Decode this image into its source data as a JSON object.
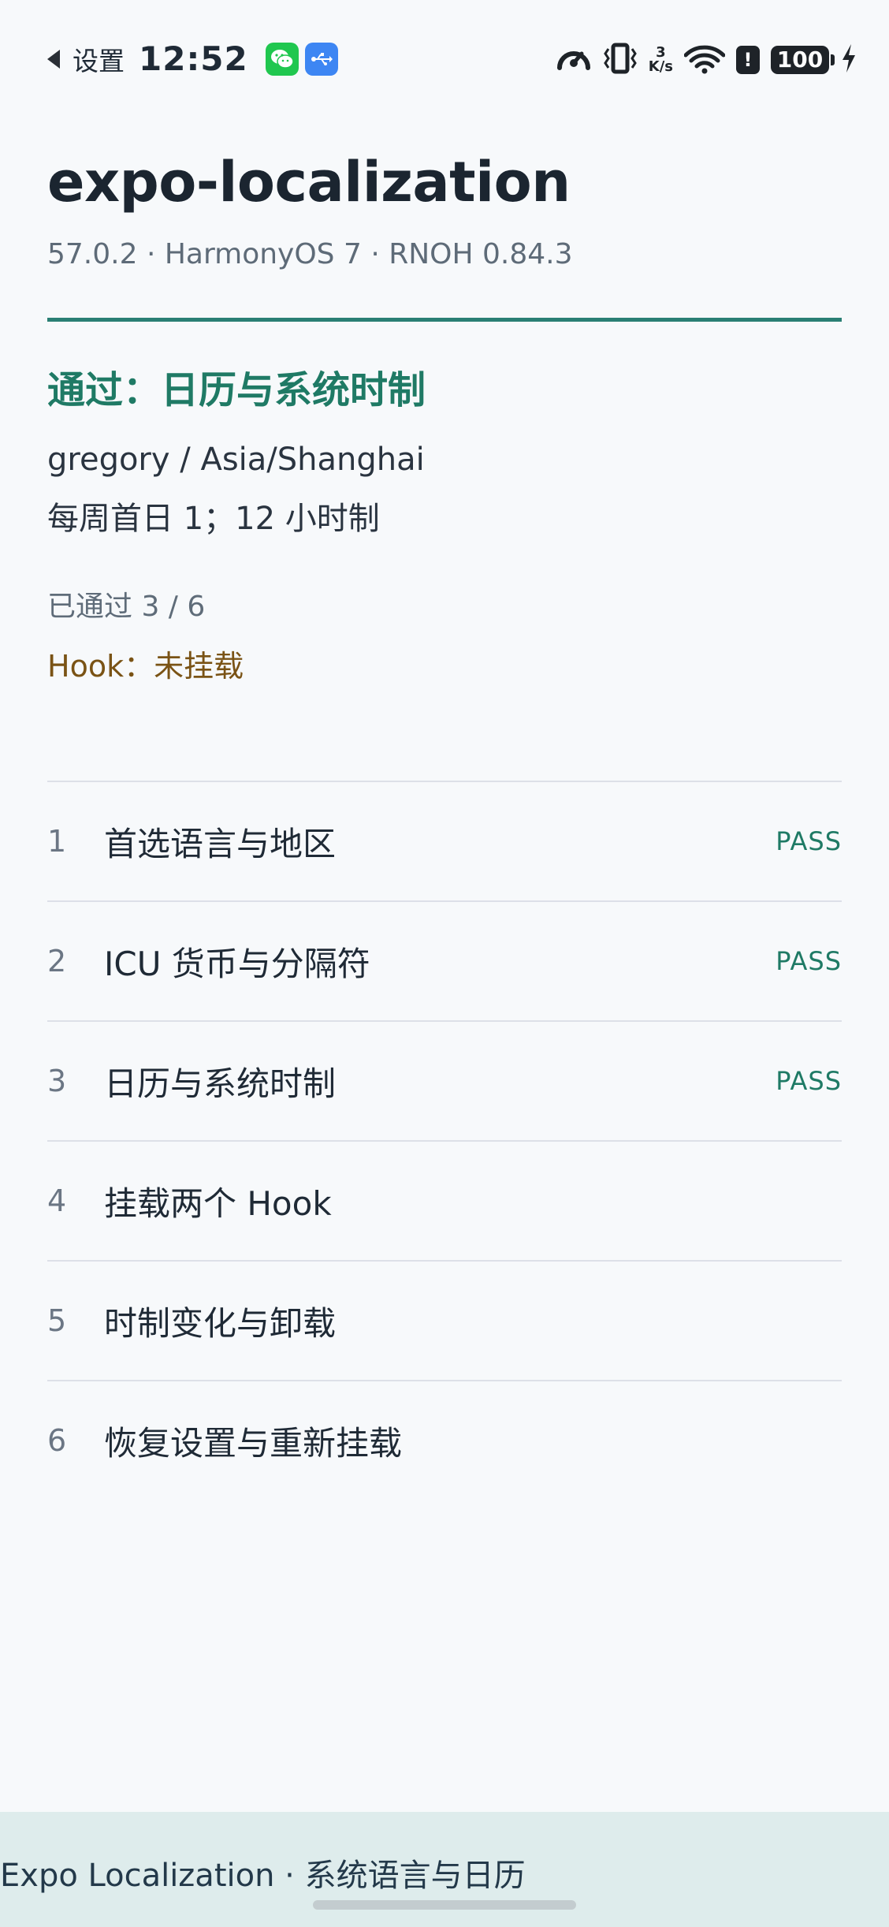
{
  "status_bar": {
    "back_app": "设置",
    "time": "12:52",
    "net_speed_value": "3",
    "net_speed_unit": "K/s",
    "alert": "!",
    "battery": "100"
  },
  "header": {
    "title": "expo-localization",
    "subtitle": "57.0.2 · HarmonyOS 7 · RNOH 0.84.3"
  },
  "summary": {
    "pass_heading": "通过：日历与系统时制",
    "calendar_info": "gregory / Asia/Shanghai",
    "week_info": "每周首日 1；12 小时制",
    "passed_count": "已通过 3 / 6",
    "hook_status": "Hook：未挂载"
  },
  "tests": [
    {
      "num": "1",
      "label": "首选语言与地区",
      "status": "PASS"
    },
    {
      "num": "2",
      "label": "ICU 货币与分隔符",
      "status": "PASS"
    },
    {
      "num": "3",
      "label": "日历与系统时制",
      "status": "PASS"
    },
    {
      "num": "4",
      "label": "挂载两个 Hook",
      "status": ""
    },
    {
      "num": "5",
      "label": "时制变化与卸载",
      "status": ""
    },
    {
      "num": "6",
      "label": "恢复设置与重新挂载",
      "status": ""
    }
  ],
  "bottom_bar": {
    "label": "Expo Localization · 系统语言与日历"
  },
  "colors": {
    "accent": "#2a7f74",
    "pass": "#1f7a65",
    "hook_warning": "#7a5315",
    "background": "#f7f9fb",
    "bottom_bar": "#deecec"
  },
  "icons": [
    "back-arrow-icon",
    "wechat-icon",
    "usb-icon",
    "speedometer-icon",
    "vibrate-icon",
    "wifi-icon",
    "alert-icon",
    "battery-icon",
    "charging-icon"
  ]
}
